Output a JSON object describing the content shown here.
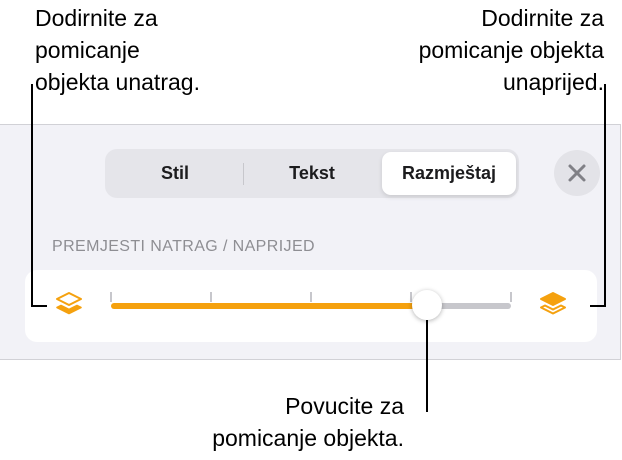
{
  "callouts": {
    "back": [
      "Dodirnite za",
      "pomicanje",
      "objekta unatrag."
    ],
    "front": [
      "Dodirnite za",
      "pomicanje objekta",
      "unaprijed."
    ],
    "drag": [
      "Povucite za",
      "pomicanje objekta."
    ]
  },
  "tabs": [
    {
      "label": "Stil",
      "selected": false
    },
    {
      "label": "Tekst",
      "selected": false
    },
    {
      "label": "Razmještaj",
      "selected": true
    }
  ],
  "close_button": {
    "icon": "close-icon"
  },
  "section_label": "PREMJESTI NATRAG / NAPRIJED",
  "slider": {
    "value_fraction": 0.79,
    "ticks": 5,
    "back_icon": "layers-back-icon",
    "front_icon": "layers-front-icon"
  },
  "colors": {
    "accent": "#f5a10e",
    "track": "#c7c7cc",
    "panel_background": "#f2f2f7"
  }
}
